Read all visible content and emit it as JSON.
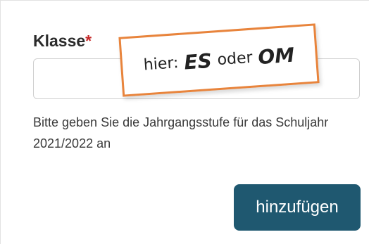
{
  "field": {
    "label": "Klasse",
    "required_marker": "*",
    "value": "",
    "help_text": "Bitte geben Sie die Jahrgangsstufe für das Schuljahr 2021/2022 an"
  },
  "actions": {
    "submit_label": "hinzufügen"
  },
  "annotation": {
    "prefix": "hier:",
    "option1": "ES",
    "connector": "oder",
    "option2": "OM"
  },
  "colors": {
    "button_bg": "#1f5870",
    "required": "#c62828",
    "note_border": "#e8843c"
  }
}
